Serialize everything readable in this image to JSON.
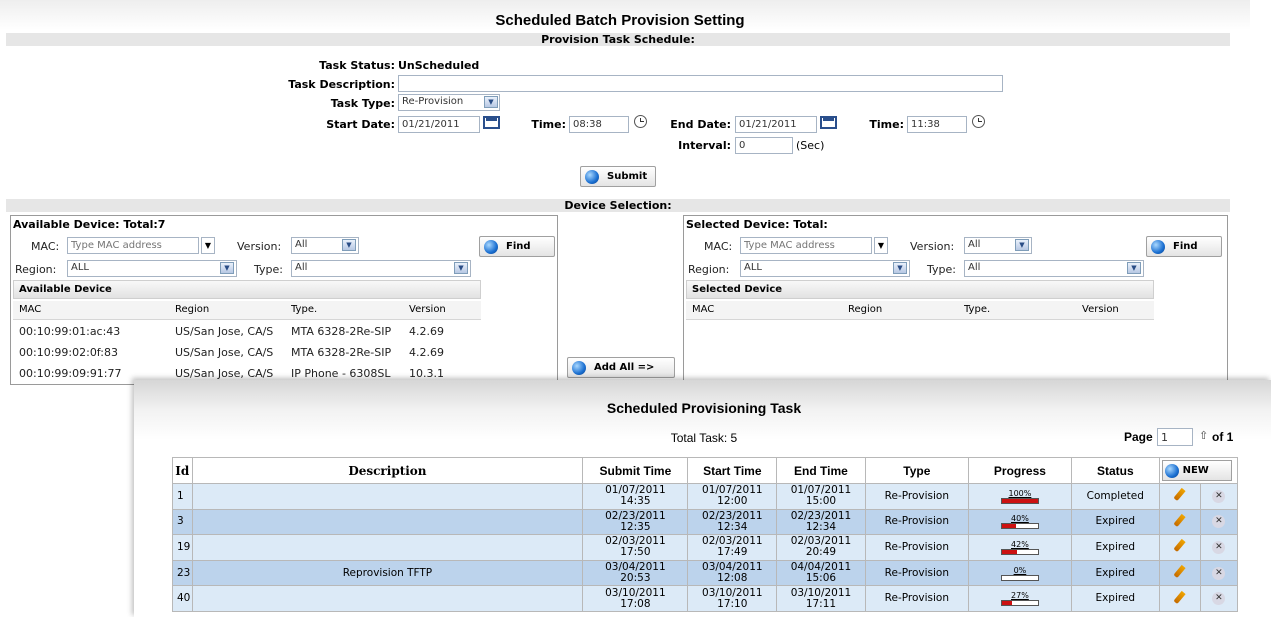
{
  "title": "Scheduled Batch Provision Setting",
  "schedule_section": "Provision Task Schedule:",
  "form": {
    "task_status_label": "Task Status:",
    "task_status_value": "UnScheduled",
    "task_description_label": "Task Description:",
    "task_description_value": "",
    "task_type_label": "Task Type:",
    "task_type_value": "Re-Provision",
    "start_date_label": "Start Date:",
    "start_date_value": "01/21/2011",
    "start_time_label": "Time:",
    "start_time_value": "08:38",
    "end_date_label": "End Date:",
    "end_date_value": "01/21/2011",
    "end_time_label": "Time:",
    "end_time_value": "11:38",
    "interval_label": "Interval:",
    "interval_value": "0",
    "interval_unit": "(Sec)",
    "submit_label": "Submit"
  },
  "device_section": "Device Selection:",
  "available": {
    "title": "Available Device: Total:7",
    "mac_label": "MAC:",
    "mac_placeholder": "Type MAC address",
    "version_label": "Version:",
    "version_value": "All",
    "region_label": "Region:",
    "region_value": "ALL",
    "type_label": "Type:",
    "type_value": "All",
    "find_label": "Find",
    "grid_title": "Available Device",
    "columns": [
      "MAC",
      "Region",
      "Type.",
      "Version"
    ],
    "rows": [
      {
        "mac": "00:10:99:01:ac:43",
        "region": "US/San Jose, CA/S",
        "type": "MTA 6328-2Re-SIP",
        "version": "4.2.69"
      },
      {
        "mac": "00:10:99:02:0f:83",
        "region": "US/San Jose, CA/S",
        "type": "MTA 6328-2Re-SIP",
        "version": "4.2.69"
      },
      {
        "mac": "00:10:99:09:91:77",
        "region": "US/San Jose, CA/S",
        "type": "IP Phone - 6308SL",
        "version": "10.3.1"
      }
    ]
  },
  "add_all_label": "Add All =>",
  "selected": {
    "title": "Selected Device: Total:",
    "mac_label": "MAC:",
    "mac_placeholder": "Type MAC address",
    "version_label": "Version:",
    "version_value": "All",
    "region_label": "Region:",
    "region_value": "ALL",
    "type_label": "Type:",
    "type_value": "All",
    "find_label": "Find",
    "grid_title": "Selected Device",
    "columns": [
      "MAC",
      "Region",
      "Type.",
      "Version"
    ]
  },
  "tasks": {
    "title": "Scheduled Provisioning Task",
    "total": "Total Task: 5",
    "page_label": "Page",
    "page_value": "1",
    "page_of": "of 1",
    "columns": {
      "id": "Id",
      "description": "Description",
      "submit": "Submit Time",
      "start": "Start Time",
      "end": "End Time",
      "type": "Type",
      "progress": "Progress",
      "status": "Status",
      "new": "NEW"
    },
    "rows": [
      {
        "id": "1",
        "description": "",
        "submit_date": "01/07/2011",
        "submit_time": "14:35",
        "start_date": "01/07/2011",
        "start_time": "12:00",
        "end_date": "01/07/2011",
        "end_time": "15:00",
        "type": "Re-Provision",
        "progress_label": "100%",
        "progress": 100,
        "status": "Completed"
      },
      {
        "id": "3",
        "description": "",
        "submit_date": "02/23/2011",
        "submit_time": "12:35",
        "start_date": "02/23/2011",
        "start_time": "12:34",
        "end_date": "02/23/2011",
        "end_time": "12:34",
        "type": "Re-Provision",
        "progress_label": "40%",
        "progress": 40,
        "status": "Expired"
      },
      {
        "id": "19",
        "description": "",
        "submit_date": "02/03/2011",
        "submit_time": "17:50",
        "start_date": "02/03/2011",
        "start_time": "17:49",
        "end_date": "02/03/2011",
        "end_time": "20:49",
        "type": "Re-Provision",
        "progress_label": "42%",
        "progress": 42,
        "status": "Expired"
      },
      {
        "id": "23",
        "description": "Reprovision TFTP",
        "submit_date": "03/04/2011",
        "submit_time": "20:53",
        "start_date": "03/04/2011",
        "start_time": "12:08",
        "end_date": "04/04/2011",
        "end_time": "15:06",
        "type": "Re-Provision",
        "progress_label": "0%",
        "progress": 0,
        "status": "Expired"
      },
      {
        "id": "40",
        "description": "",
        "submit_date": "03/10/2011",
        "submit_time": "17:08",
        "start_date": "03/10/2011",
        "start_time": "17:10",
        "end_date": "03/10/2011",
        "end_time": "17:11",
        "type": "Re-Provision",
        "progress_label": "27%",
        "progress": 27,
        "status": "Expired"
      }
    ]
  }
}
